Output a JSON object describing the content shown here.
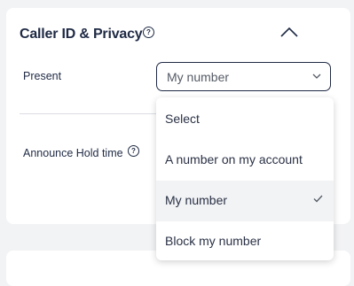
{
  "section": {
    "title": "Caller ID & Privacy",
    "help_icon": "question-circle-icon",
    "collapse_icon": "chevron-up-icon"
  },
  "present": {
    "label": "Present",
    "selected_value": "My number",
    "chevron_icon": "chevron-down-icon"
  },
  "announce": {
    "label": "Announce Hold time",
    "help_icon": "question-circle-icon"
  },
  "dropdown": {
    "options": [
      {
        "label": "Select",
        "selected": false
      },
      {
        "label": "A number on my account",
        "selected": false
      },
      {
        "label": "My number",
        "selected": true
      },
      {
        "label": "Block my number",
        "selected": false
      }
    ],
    "check_icon": "checkmark-icon"
  },
  "colors": {
    "text": "#1f2a44",
    "selected_bg": "#f2f3f5",
    "border": "#1f2a44"
  }
}
